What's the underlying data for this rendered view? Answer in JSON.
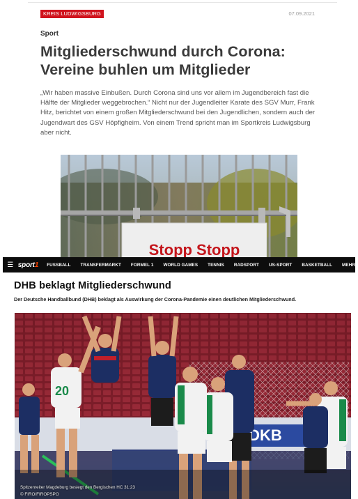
{
  "article1": {
    "category_tag": "KREIS LUDWIGSBURG",
    "date": "07.09.2021",
    "kicker": "Sport",
    "title": "Mitgliederschwund durch Corona: Vereine buhlen um Mitglieder",
    "lead": "„Wir haben massive Einbußen. Durch Corona sind uns vor allem im Jugendbereich fast die Hälfte der Mitglieder weggebrochen.“ Nicht nur der Jugendleiter Karate des SGV Murr, Frank Hitz, berichtet von einem großen Mitgliederschwund bei den Jugendlichen, sondern auch der Jugendwart des GSV Höpfigheim. Von einem Trend spricht man im Sportkreis Ludwigsburg aber nicht.",
    "photo_sign_text": "Stopp Stopp"
  },
  "article2": {
    "nav": {
      "menu_icon": "hamburger-menu-icon",
      "logo_text": "sport",
      "logo_suffix": "1",
      "items": [
        "FUSSBALL",
        "TRANSFERMARKT",
        "FORMEL 1",
        "WORLD GAMES",
        "TENNIS",
        "RADSPORT",
        "US-SPORT",
        "BASKETBALL",
        "MEHR"
      ]
    },
    "title": "DHB beklagt Mitgliederschwund",
    "lead": "Der Deutsche Handballbund (DHB) beklagt als Auswirkung der Corona-Pandemie einen deutlichen Mitgliederschwund.",
    "photo": {
      "jersey_number": "20",
      "banner_text": "DKB",
      "caption": "Spitzenreiter Magdeburg besiegt den Bergischen HC 31:23",
      "credit": "© FIRO/FIROPSPO"
    },
    "colors": {
      "nav_bg": "#0d0d0d",
      "logo_accent": "#ff4200"
    }
  },
  "colors": {
    "tag_red": "#d0131d",
    "sign_red": "#c4161c"
  }
}
